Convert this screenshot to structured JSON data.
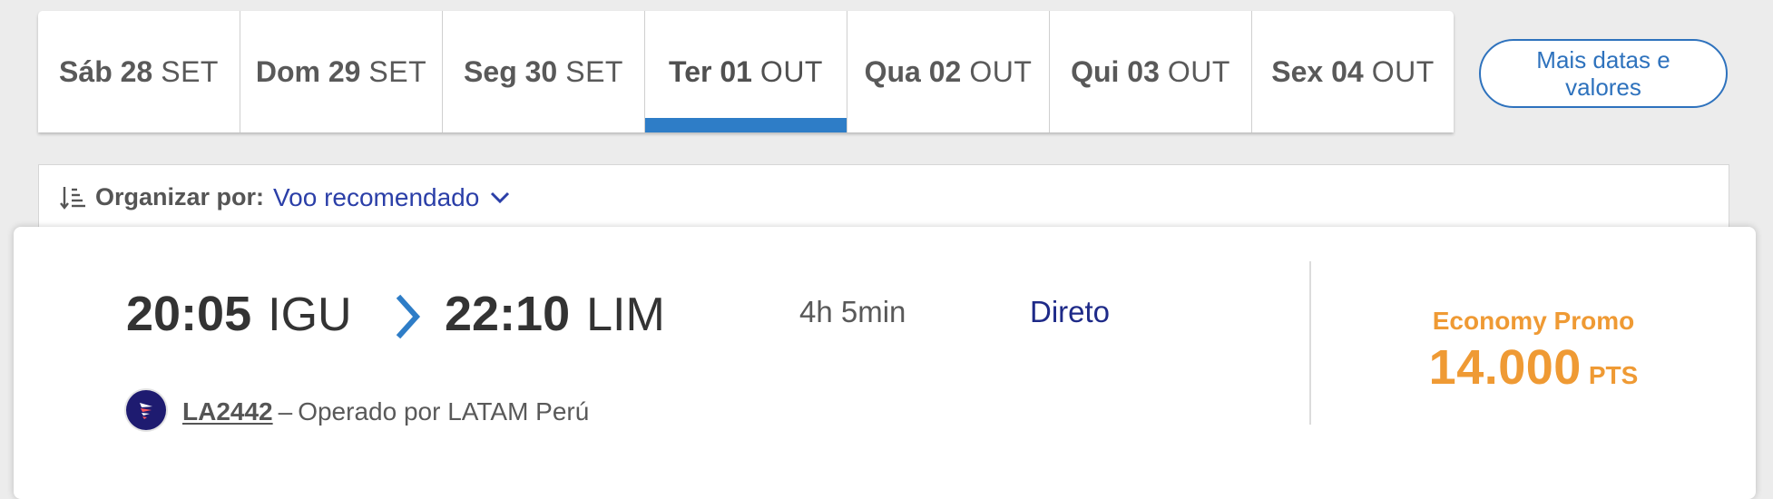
{
  "date_tabs": [
    {
      "day": "Sáb 28",
      "month": "SET",
      "active": false
    },
    {
      "day": "Dom 29",
      "month": "SET",
      "active": false
    },
    {
      "day": "Seg 30",
      "month": "SET",
      "active": false
    },
    {
      "day": "Ter 01",
      "month": "OUT",
      "active": true
    },
    {
      "day": "Qua 02",
      "month": "OUT",
      "active": false
    },
    {
      "day": "Qui 03",
      "month": "OUT",
      "active": false
    },
    {
      "day": "Sex 04",
      "month": "OUT",
      "active": false
    }
  ],
  "more_dates_label": "Mais datas e valores",
  "sort": {
    "label": "Organizar por:",
    "selected": "Voo recomendado",
    "icon": "sort-icon"
  },
  "flight": {
    "departure_time": "20:05",
    "departure_airport": "IGU",
    "arrival_time": "22:10",
    "arrival_airport": "LIM",
    "duration": "4h 5min",
    "stops": "Direto",
    "flight_number": "LA2442",
    "separator": "–",
    "operator": "Operado por LATAM Perú",
    "fare_class": "Economy Promo",
    "fare_points": "14.000",
    "fare_unit": "PTS"
  },
  "colors": {
    "accent_blue": "#2e7dc7",
    "link_blue": "#2b3fa8",
    "stops_navy": "#1e2a88",
    "fare_orange": "#ef9a34",
    "background": "#ececec"
  }
}
